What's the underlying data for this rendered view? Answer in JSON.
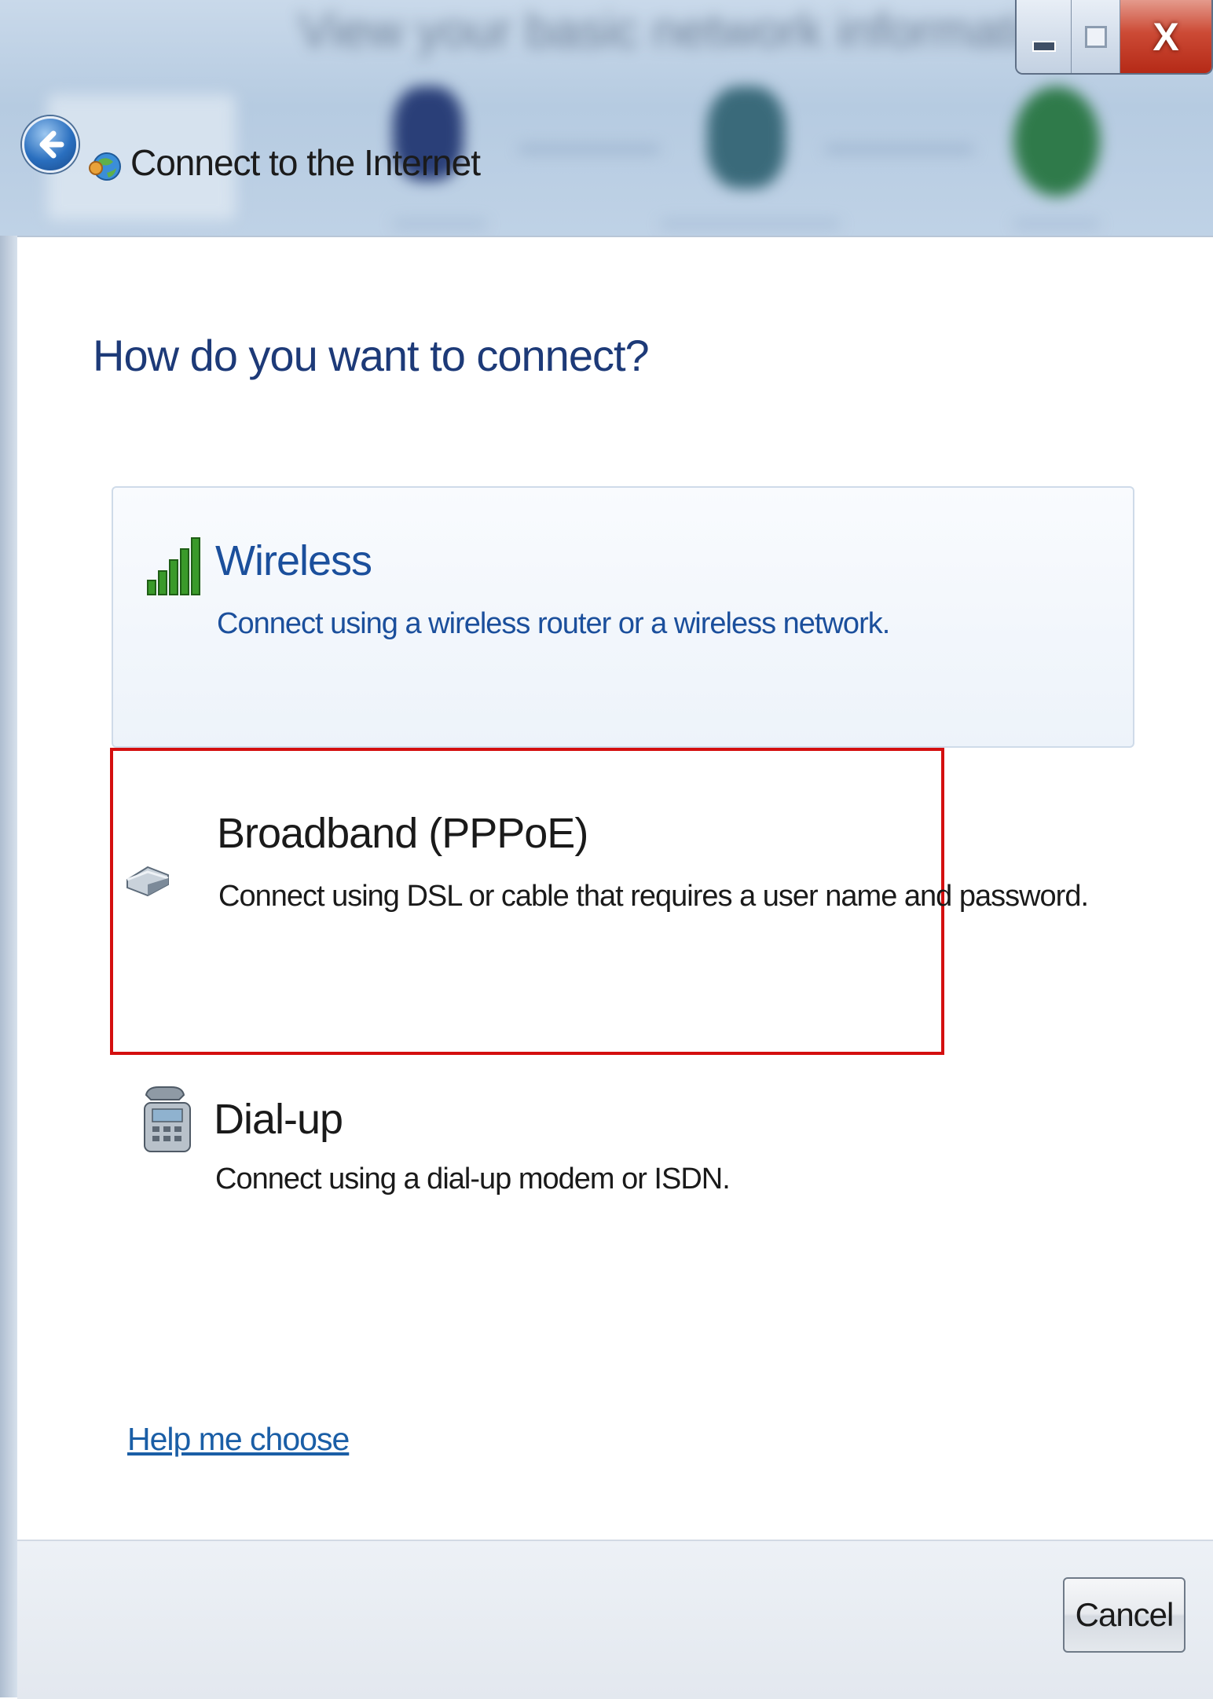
{
  "titlebar": {
    "background_text": "View your basic network information and set up connections",
    "close_glyph": "X",
    "wizard_title": "Connect to the Internet"
  },
  "main": {
    "heading": "How do you want to connect?",
    "options": [
      {
        "title": "Wireless",
        "description": "Connect using a wireless router or a wireless network.",
        "icon": "signal-bars-icon"
      },
      {
        "title": "Broadband (PPPoE)",
        "description": "Connect using DSL or cable that requires a user name and password.",
        "icon": "modem-icon"
      },
      {
        "title": "Dial-up",
        "description": "Connect using a dial-up modem or ISDN.",
        "icon": "telephone-icon"
      }
    ],
    "help_link": "Help me choose"
  },
  "footer": {
    "cancel_label": "Cancel"
  },
  "colors": {
    "heading": "#1d3a78",
    "link": "#1a5ea6",
    "highlight": "#d40f0f"
  }
}
